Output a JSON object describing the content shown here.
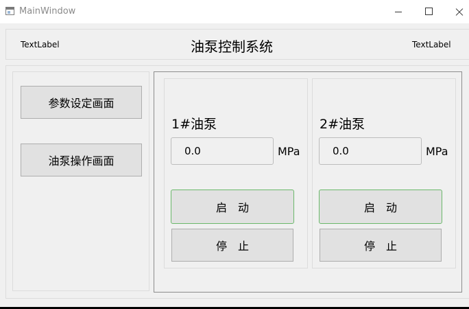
{
  "window": {
    "title": "MainWindow"
  },
  "header": {
    "left_label": "TextLabel",
    "title": "油泵控制系统",
    "right_label": "TextLabel"
  },
  "nav": {
    "params_button": "参数设定画面",
    "operation_button": "油泵操作画面"
  },
  "pumps": [
    {
      "title": "1#油泵",
      "pressure": "0.0",
      "unit": "MPa",
      "start_label": "启　动",
      "stop_label": "停　止"
    },
    {
      "title": "2#油泵",
      "pressure": "0.0",
      "unit": "MPa",
      "start_label": "启　动",
      "stop_label": "停　止"
    }
  ],
  "colors": {
    "start_border": "#6ab86a",
    "button_bg": "#e1e1e1",
    "window_bg": "#f0f0f0"
  },
  "icons": [
    "app-window-icon",
    "minimize-icon",
    "maximize-icon",
    "close-icon"
  ]
}
